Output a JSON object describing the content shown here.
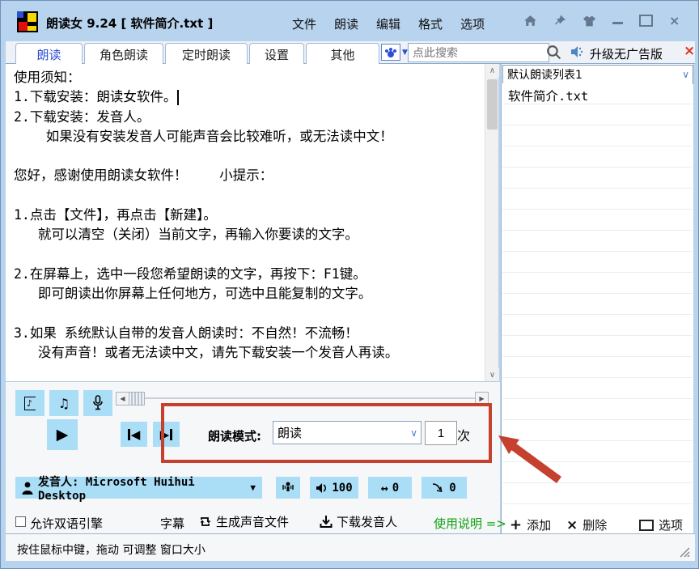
{
  "window": {
    "title": "朗读女 9.24  [ 软件简介.txt ]",
    "menu": [
      "文件",
      "朗读",
      "编辑",
      "格式",
      "选项"
    ],
    "status": "按住鼠标中键，拖动 可调整 窗口大小"
  },
  "tabs": [
    "朗读",
    "角色朗读",
    "定时朗读",
    "设置",
    "其他"
  ],
  "active_tab": "朗读",
  "toolbar": {
    "search_placeholder": "点此搜索",
    "upgrade_label": "升级无广告版"
  },
  "editor": {
    "text": "使用须知：\n1.下载安装：朗读女软件。\n2.下载安装：发音人。\n    如果没有安装发音人可能声音会比较难听，或无法读中文！\n\n您好，感谢使用朗读女软件！    小提示：\n\n1.点击【文件】，再点击【新建】。\n   就可以清空（关闭）当前文字，再输入你要读的文字。\n\n2.在屏幕上，选中一段您希望朗读的文字，再按下：F1键。\n   即可朗读出你屏幕上任何地方，可选中且能复制的文字。\n\n3.如果 系统默认自带的发音人朗读时：不自然！不流畅！\n   没有声音！或者无法读中文，请先下载安装一个发音人再读。"
  },
  "playlist": {
    "selected_list": "默认朗读列表1",
    "items": [
      "软件简介.txt"
    ],
    "add_label": "添加",
    "delete_label": "删除",
    "options_label": "选项"
  },
  "playback": {
    "mode_label": "朗读模式:",
    "mode_value": "朗读",
    "repeat_count": "1",
    "repeat_unit": "次"
  },
  "voice": {
    "label": "发音人: Microsoft Huihui Desktop",
    "volume": "100",
    "rate": "0",
    "pitch": "0"
  },
  "footer": {
    "bilingual_label": "允许双语引擎",
    "subtitle_label": "字幕",
    "generate_label": "生成声音文件",
    "download_label": "下载发音人",
    "help_label": "使用说明 =>"
  },
  "colors": {
    "titlebar_blue": "#b8d3ee",
    "button_blue": "#aaddf6",
    "annotation_red": "#c5402e",
    "help_green": "#12a212",
    "active_tab_text": "#2b50d0",
    "close_red": "#e03020"
  },
  "icons": {
    "app_logo": "black square with blue/yellow/red quadrants",
    "titlebar": [
      "home-icon",
      "pin-icon",
      "skin-icon",
      "minimize-icon",
      "maximize-icon",
      "close-icon"
    ],
    "image_search": "paw-icon with dropdown",
    "search": "magnifier",
    "upgrade": "speaker-icon",
    "player": [
      "boxed-note-icon",
      "music-note-icon",
      "microphone-icon",
      "play-icon",
      "prev-icon",
      "next-icon"
    ],
    "voice_row": [
      "person-icon",
      "voice-test-icon",
      "volume-icon",
      "rate-icon",
      "pitch-icon"
    ],
    "footer_row": [
      "generate-loop-icon",
      "download-icon",
      "add-plus-icon",
      "delete-x-icon",
      "options-rect-icon"
    ],
    "misc": [
      "resize-grip",
      "annotation-arrow",
      "annotation-rectangle"
    ]
  }
}
